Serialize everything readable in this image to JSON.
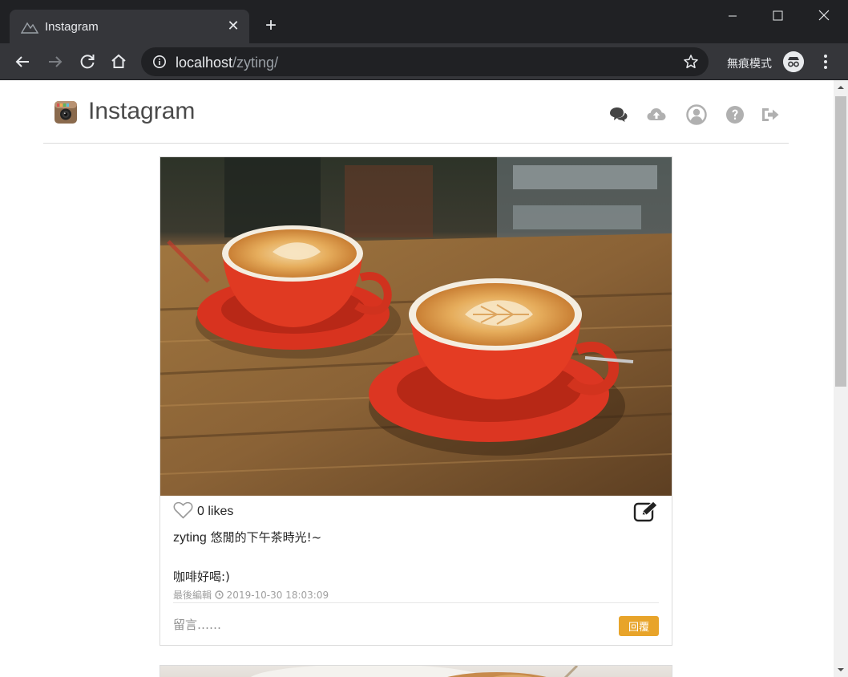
{
  "browser": {
    "tab_title": "Instagram",
    "tab_close": "✕",
    "new_tab": "+",
    "url_host": "localhost",
    "url_path": "/zyting/",
    "incognito_label": "無痕模式"
  },
  "site": {
    "logo_text": "Instagram"
  },
  "post": {
    "likes": "0 likes",
    "author": "zyting",
    "caption": " 悠閒的下午茶時光!~\n\n咖啡好喝:)",
    "edited_label": "最後編輯",
    "timestamp": "2019-10-30 18:03:09",
    "comment_placeholder": "留言……",
    "reply_label": "回覆"
  },
  "colors": {
    "reply_button": "#e8a42a",
    "header_icons": "#b0b0b0",
    "chat_icon": "#444444"
  }
}
